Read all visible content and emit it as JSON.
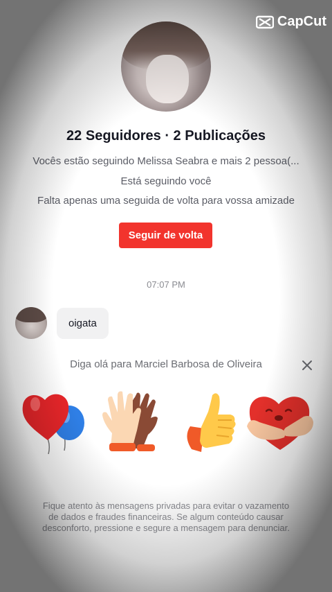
{
  "watermark": {
    "text": "CapCut"
  },
  "profile": {
    "stats": "22 Seguidores · 2 Publicações",
    "following_info": "Vocês estão seguindo Melissa Seabra e mais 2 pessoa(...",
    "follows_you": "Está seguindo você",
    "friend_hint": "Falta apenas uma seguida de volta para vossa amizade",
    "follow_back_label": "Seguir de volta"
  },
  "chat": {
    "timestamp": "07:07 PM",
    "messages": [
      {
        "text": "oigata"
      }
    ]
  },
  "greeting": {
    "text": "Diga olá para Marciel Barbosa de Oliveira",
    "stickers": [
      "heart-balloons-icon",
      "high-five-hands-icon",
      "thumbs-up-icon",
      "heart-hug-icon"
    ]
  },
  "footer": {
    "notice": "Fique atento às mensagens privadas para evitar o vazamento de dados e fraudes financeiras. Se algum conteúdo causar desconforto, pressione e segure a mensagem para denunciar."
  },
  "colors": {
    "accent": "#f2342d",
    "text": "#161823",
    "muted": "#8a8b91"
  }
}
